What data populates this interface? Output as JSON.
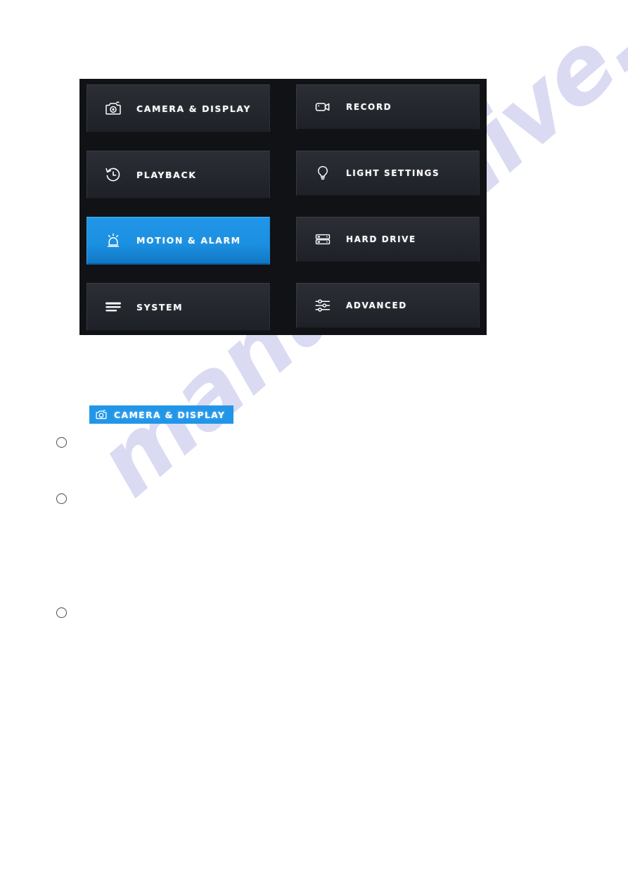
{
  "panel": {
    "menu_left": [
      {
        "label": "CAMERA & DISPLAY",
        "icon": "camera-icon",
        "active": false
      },
      {
        "label": "PLAYBACK",
        "icon": "playback-history-icon",
        "active": false
      },
      {
        "label": "MOTION & ALARM",
        "icon": "alarm-siren-icon",
        "active": true
      },
      {
        "label": "SYSTEM",
        "icon": "menu-lines-icon",
        "active": false
      }
    ],
    "menu_right": [
      {
        "label": "RECORD",
        "icon": "video-camera-icon",
        "active": false
      },
      {
        "label": "LIGHT SETTINGS",
        "icon": "lightbulb-icon",
        "active": false
      },
      {
        "label": "HARD DRIVE",
        "icon": "hard-drive-icon",
        "active": false
      },
      {
        "label": "ADVANCED",
        "icon": "sliders-icon",
        "active": false
      }
    ]
  },
  "inline_badge": {
    "label": "CAMERA & DISPLAY",
    "icon": "camera-icon"
  },
  "watermark": {
    "text": "manualshive.com"
  },
  "colors": {
    "accent_blue": "#2196e8",
    "panel_background": "#111215",
    "tile_background": "#272a30",
    "page_background": "#ffffff",
    "watermark_color": "#8e8ed8"
  }
}
